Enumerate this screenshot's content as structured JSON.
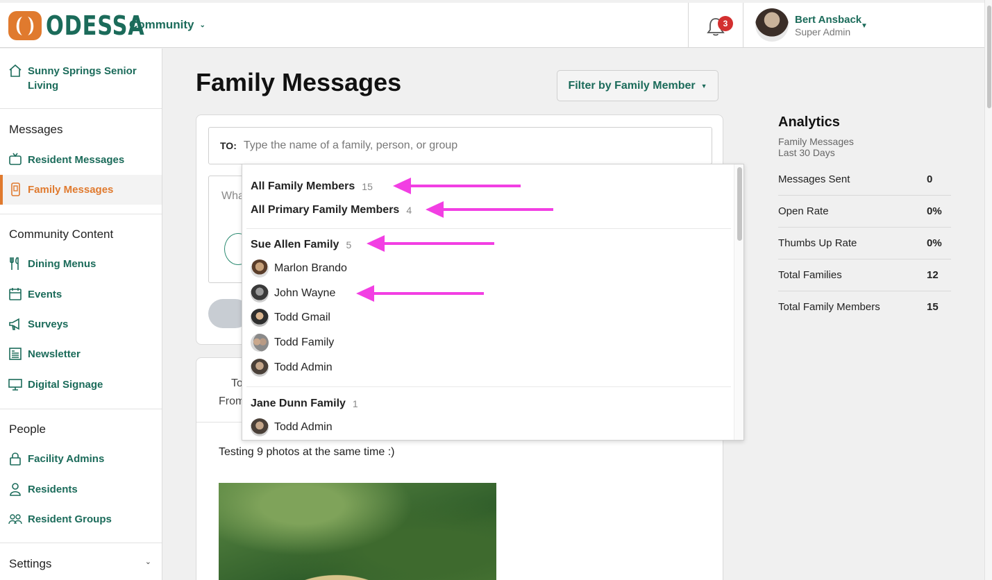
{
  "header": {
    "logo_text": "ODESSA",
    "community_label": "Community",
    "notification_count": "3",
    "user": {
      "name": "Bert Ansback",
      "role": "Super Admin"
    }
  },
  "sidebar": {
    "facility": "Sunny Springs Senior Living",
    "sections": [
      {
        "title": "Messages",
        "items": [
          {
            "label": "Resident Messages",
            "icon": "tv-icon"
          },
          {
            "label": "Family Messages",
            "icon": "phone-icon",
            "active": true
          }
        ]
      },
      {
        "title": "Community Content",
        "items": [
          {
            "label": "Dining Menus",
            "icon": "utensils-icon"
          },
          {
            "label": "Events",
            "icon": "calendar-icon"
          },
          {
            "label": "Surveys",
            "icon": "megaphone-icon"
          },
          {
            "label": "Newsletter",
            "icon": "newspaper-icon"
          },
          {
            "label": "Digital Signage",
            "icon": "monitor-icon"
          }
        ]
      },
      {
        "title": "People",
        "items": [
          {
            "label": "Facility Admins",
            "icon": "lock-icon"
          },
          {
            "label": "Residents",
            "icon": "person-icon"
          },
          {
            "label": "Resident Groups",
            "icon": "group-icon"
          }
        ]
      }
    ],
    "settings_label": "Settings"
  },
  "main": {
    "title": "Family Messages",
    "filter_button": "Filter by Family Member",
    "compose": {
      "to_label": "TO:",
      "to_placeholder": "Type the name of a family, person, or group",
      "message_placeholder": "Wha"
    },
    "feed": {
      "to_label": "To",
      "from_label": "From",
      "text": "Testing 9 photos at the same time :)"
    }
  },
  "dropdown": {
    "groups_all": [
      {
        "label": "All Family Members",
        "count": "15"
      },
      {
        "label": "All Primary Family Members",
        "count": "4"
      }
    ],
    "families": [
      {
        "label": "Sue Allen Family",
        "count": "5",
        "members": [
          "Marlon Brando",
          "John Wayne",
          "Todd Gmail",
          "Todd Family",
          "Todd Admin"
        ]
      },
      {
        "label": "Jane Dunn Family",
        "count": "1",
        "members": [
          "Todd Admin"
        ]
      }
    ]
  },
  "analytics": {
    "title": "Analytics",
    "subtitle": "Family Messages",
    "period": "Last 30 Days",
    "rows": [
      {
        "label": "Messages Sent",
        "value": "0"
      },
      {
        "label": "Open Rate",
        "value": "0%"
      },
      {
        "label": "Thumbs Up Rate",
        "value": "0%"
      },
      {
        "label": "Total Families",
        "value": "12"
      },
      {
        "label": "Total Family Members",
        "value": "15"
      }
    ]
  },
  "colors": {
    "brand": "#1b6b5a",
    "accent": "#e07a2e",
    "annotation": "#f23fe3",
    "badge": "#d32f2f"
  }
}
